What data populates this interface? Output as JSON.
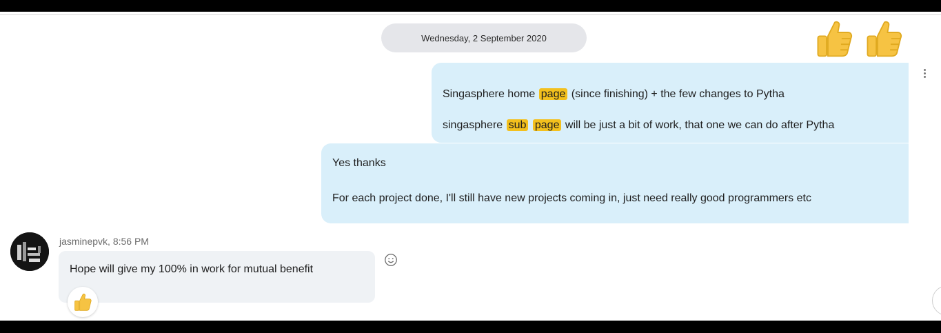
{
  "chat": {
    "date_separator": "Wednesday, 2 September 2020",
    "outgoing_reactions": [
      "thumbs-up-icon",
      "thumbs-up-icon"
    ],
    "messages_out": [
      {
        "lines": [
          {
            "parts": [
              {
                "text": "Singasphere home ",
                "highlight": false
              },
              {
                "text": "page",
                "highlight": true
              },
              {
                "text": " (since finishing) + the few changes to Pytha",
                "highlight": false
              }
            ]
          },
          {
            "parts": [
              {
                "text": "singasphere ",
                "highlight": false
              },
              {
                "text": "sub",
                "highlight": true
              },
              {
                "text": " ",
                "highlight": false
              },
              {
                "text": "page",
                "highlight": true
              },
              {
                "text": " will be just a bit of work, that one we can do after Pytha",
                "highlight": false
              }
            ]
          }
        ]
      },
      {
        "lines": [
          {
            "parts": [
              {
                "text": "Yes thanks",
                "highlight": false
              }
            ]
          },
          {
            "parts": [
              {
                "text": "For each project done, I'll still have new projects coming in, just need really good programmers etc",
                "highlight": false
              }
            ]
          }
        ]
      }
    ],
    "incoming": {
      "sender": "jasminepvk",
      "time": "8:56 PM",
      "meta_separator": ", ",
      "text": "Hope will give my 100% in work for mutual benefit",
      "reaction": "thumbs-up-icon"
    }
  },
  "colors": {
    "outgoing_bubble": "#d9effa",
    "incoming_bubble": "#eff2f5",
    "highlight": "#f3c01d",
    "date_pill": "#e5e6ea"
  }
}
